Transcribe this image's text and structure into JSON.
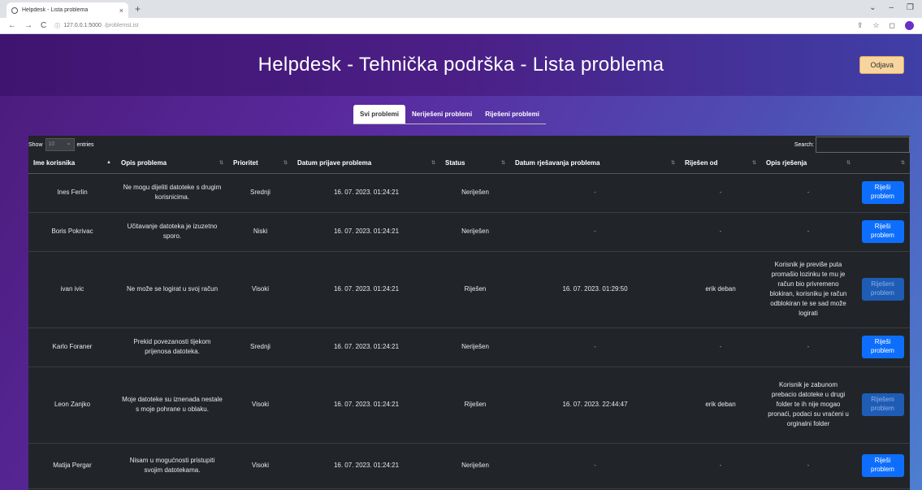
{
  "browser": {
    "tab_title": "Helpdesk - Lista problema",
    "tab_close": "×",
    "new_tab": "+",
    "url_host": "127.0.0.1:5000",
    "url_path": "/problemsList",
    "window_controls": [
      "⌄",
      "–",
      "❐"
    ]
  },
  "header": {
    "title": "Helpdesk - Tehnička podrška - Lista problema",
    "logout_label": "Odjava"
  },
  "filters": [
    "Svi problemi",
    "Neriješeni problemi",
    "Riješeni problemi"
  ],
  "table_controls": {
    "show_label": "Show",
    "show_value": "10",
    "entries_label": "entries",
    "search_label": "Search:"
  },
  "columns": [
    "Ime korisnika",
    "Opis problema",
    "Prioritet",
    "Datum prijave problema",
    "Status",
    "Datum rješavanja problema",
    "Riješen od",
    "Opis rješenja",
    ""
  ],
  "rows": [
    {
      "user": "Ines Ferlin",
      "desc": "Ne mogu dijeliti datoteke s drugim korisnicima.",
      "priority": "Srednji",
      "reported": "16. 07. 2023. 01:24:21",
      "status": "Neriješen",
      "resolved_at": "-",
      "resolved_by": "-",
      "solution": "-",
      "action": "Riješi problem",
      "action_enabled": true
    },
    {
      "user": "Boris Pokrivac",
      "desc": "Učitavanje datoteka je izuzetno sporo.",
      "priority": "Niski",
      "reported": "16. 07. 2023. 01:24:21",
      "status": "Neriješen",
      "resolved_at": "-",
      "resolved_by": "-",
      "solution": "-",
      "action": "Riješi problem",
      "action_enabled": true
    },
    {
      "user": "ivan ivic",
      "desc": "Ne može se logirat u svoj račun",
      "priority": "Visoki",
      "reported": "16. 07. 2023. 01:24:21",
      "status": "Riješen",
      "resolved_at": "16. 07. 2023. 01:29:50",
      "resolved_by": "erik deban",
      "solution": "Korisnik je previše puta promašio lozinku te mu je račun bio privremeno blokiran, korisniku je račun odblokiran te se sad može logirati",
      "action": "Riješeni problem",
      "action_enabled": false
    },
    {
      "user": "Karlo Foraner",
      "desc": "Prekid povezanosti tijekom prijenosa datoteka.",
      "priority": "Srednji",
      "reported": "16. 07. 2023. 01:24:21",
      "status": "Neriješen",
      "resolved_at": "-",
      "resolved_by": "-",
      "solution": "-",
      "action": "Riješi problem",
      "action_enabled": true
    },
    {
      "user": "Leon Zanjko",
      "desc": "Moje datoteke su iznenada nestale s moje pohrane u oblaku.",
      "priority": "Visoki",
      "reported": "16. 07. 2023. 01:24:21",
      "status": "Riješen",
      "resolved_at": "16. 07. 2023. 22:44:47",
      "resolved_by": "erik deban",
      "solution": "Korisnik je zabunom prebacio datoteke u drugi folder te ih nije mogao pronaći, podaci su vraćeni u orginalni folder",
      "action": "Riješeni problem",
      "action_enabled": false
    },
    {
      "user": "Matija Pergar",
      "desc": "Nisam u mogućnosti pristupiti svojim datotekama.",
      "priority": "Visoki",
      "reported": "16. 07. 2023. 01:24:21",
      "status": "Neriješen",
      "resolved_at": "-",
      "resolved_by": "-",
      "solution": "-",
      "action": "Riješi problem",
      "action_enabled": true
    }
  ]
}
